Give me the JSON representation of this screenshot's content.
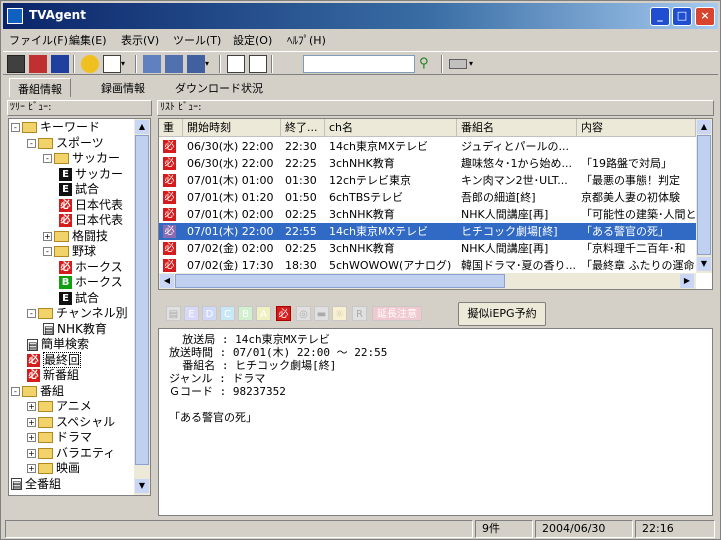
{
  "window": {
    "title": "TVAgent"
  },
  "menu": [
    "ファイル(F)",
    "編集(E)",
    "表示(V)",
    "ツール(T)",
    "設定(O)",
    "ﾍﾙﾌﾟ(H)"
  ],
  "search": {
    "value": "",
    "placeholder": ""
  },
  "tabs": [
    "番組情報",
    "録画情報",
    "ダウンロード状況"
  ],
  "tree_header": "ﾂﾘｰ ﾋﾞｭｰ:",
  "list_header": "ﾘｽﾄ ﾋﾞｭｰ:",
  "tree": [
    {
      "label": "キーワード",
      "kind": "folder",
      "exp": "-"
    },
    {
      "label": "スポーツ",
      "kind": "folder",
      "exp": "-"
    },
    {
      "label": "サッカー",
      "kind": "folder",
      "exp": "-"
    },
    {
      "label": "サッカー",
      "kind": "badge-black",
      "badge": "E"
    },
    {
      "label": "試合",
      "kind": "badge-black",
      "badge": "E"
    },
    {
      "label": "日本代表",
      "kind": "badge-red",
      "badge": "必"
    },
    {
      "label": "日本代表",
      "kind": "badge-red",
      "badge": "必"
    },
    {
      "label": "格闘技",
      "kind": "folder",
      "exp": "+"
    },
    {
      "label": "野球",
      "kind": "folder",
      "exp": "-"
    },
    {
      "label": "ホークス",
      "kind": "badge-red",
      "badge": "必"
    },
    {
      "label": "ホークス",
      "kind": "badge-green",
      "badge": "B"
    },
    {
      "label": "試合",
      "kind": "badge-black",
      "badge": "E"
    },
    {
      "label": "チャンネル別",
      "kind": "folder",
      "exp": "-"
    },
    {
      "label": "NHK教育",
      "kind": "doc",
      "badge": ""
    },
    {
      "label": "簡単検索",
      "kind": "doc",
      "badge": ""
    },
    {
      "label": "最終回",
      "kind": "badge-red",
      "badge": "必"
    },
    {
      "label": "新番組",
      "kind": "badge-red",
      "badge": "必"
    },
    {
      "label": "番組",
      "kind": "folder",
      "exp": "-"
    },
    {
      "label": "アニメ",
      "kind": "folder",
      "exp": "+"
    },
    {
      "label": "スペシャル",
      "kind": "folder",
      "exp": "+"
    },
    {
      "label": "ドラマ",
      "kind": "folder",
      "exp": "+"
    },
    {
      "label": "バラエティ",
      "kind": "folder",
      "exp": "+"
    },
    {
      "label": "映画",
      "kind": "folder",
      "exp": "+"
    },
    {
      "label": "全番組",
      "kind": "doc",
      "badge": ""
    }
  ],
  "list": {
    "columns": [
      "重",
      "開始時刻",
      "終了...",
      "ch名",
      "番組名",
      "内容"
    ],
    "rows": [
      {
        "mark": "必",
        "start": "06/30(水) 22:00",
        "end": "22:30",
        "ch": "14ch東京MXテレビ",
        "title": "ジュディとパールの...",
        "content": ""
      },
      {
        "mark": "必",
        "start": "06/30(水) 22:00",
        "end": "22:25",
        "ch": "3chNHK教育",
        "title": "趣味悠々･1から始め...",
        "content": "「19路盤で対局」"
      },
      {
        "mark": "必",
        "start": "07/01(木) 01:00",
        "end": "01:30",
        "ch": "12chテレビ東京",
        "title": "キン肉マン2世･ULT...",
        "content": "「最悪の事態！判定"
      },
      {
        "mark": "必",
        "start": "07/01(木) 01:20",
        "end": "01:50",
        "ch": "6chTBSテレビ",
        "title": "吾郎の細道[終]",
        "content": "京都美人妻の初体験"
      },
      {
        "mark": "必",
        "start": "07/01(木) 02:00",
        "end": "02:25",
        "ch": "3chNHK教育",
        "title": "NHK人間講座[再]",
        "content": "「可能性の建築･人間と"
      },
      {
        "mark": "必",
        "start": "07/01(木) 22:00",
        "end": "22:55",
        "ch": "14ch東京MXテレビ",
        "title": "ヒチコック劇場[終]",
        "content": "「ある警官の死」"
      },
      {
        "mark": "必",
        "start": "07/02(金) 02:00",
        "end": "02:25",
        "ch": "3chNHK教育",
        "title": "NHK人間講座[再]",
        "content": "「京料理千二百年･和"
      },
      {
        "mark": "必",
        "start": "07/02(金) 17:30",
        "end": "18:30",
        "ch": "5chWOWOW(アナログ)",
        "title": "韓国ドラマ･夏の香り...",
        "content": "「最終章 ふたりの運命"
      }
    ]
  },
  "detail_icons": [
    "E",
    "D",
    "C",
    "B",
    "A",
    "必",
    "延長注意"
  ],
  "epg_button": "擬似iEPG予約",
  "detail": {
    "broadcaster_label": "放送局",
    "broadcaster": "14ch東京MXテレビ",
    "time_label": "放送時間",
    "time": "07/01(木) 22:00 ～ 22:55",
    "title_label": "番組名",
    "title": "ヒチコック劇場[終]",
    "genre_label": "ジャンル",
    "genre": "ドラマ",
    "gcode_label": "Ｇコード",
    "gcode": "98237352",
    "subtitle": "「ある警官の死」"
  },
  "status": {
    "count": "9件",
    "date": "2004/06/30",
    "time": "22:16"
  }
}
